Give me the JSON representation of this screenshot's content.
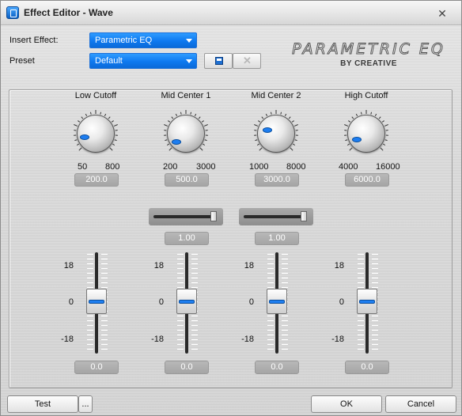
{
  "window": {
    "title": "Effect Editor - Wave",
    "close_glyph": "✕"
  },
  "insert_effect": {
    "label": "Insert Effect:",
    "value": "Parametric EQ"
  },
  "preset": {
    "label": "Preset",
    "value": "Default"
  },
  "logo": {
    "title": "PARAMETRIC EQ",
    "subtitle": "BY CREATIVE"
  },
  "bands": [
    {
      "name": "Low Cutoff",
      "range_min": "50",
      "range_max": "800",
      "value": "200.0"
    },
    {
      "name": "Mid Center 1",
      "range_min": "200",
      "range_max": "3000",
      "value": "500.0"
    },
    {
      "name": "Mid Center 2",
      "range_min": "1000",
      "range_max": "8000",
      "value": "3000.0"
    },
    {
      "name": "High Cutoff",
      "range_min": "4000",
      "range_max": "16000",
      "value": "6000.0"
    }
  ],
  "q_sliders": [
    {
      "value": "1.00",
      "level": 1.0
    },
    {
      "value": "1.00",
      "level": 1.0
    }
  ],
  "gains": {
    "max_label": "18",
    "mid_label": "0",
    "min_label": "-18",
    "values": [
      "0.0",
      "0.0",
      "0.0",
      "0.0"
    ]
  },
  "buttons": {
    "test": "Test",
    "more": "...",
    "ok": "OK",
    "cancel": "Cancel"
  },
  "colors": {
    "accent": "#0e79f0"
  }
}
